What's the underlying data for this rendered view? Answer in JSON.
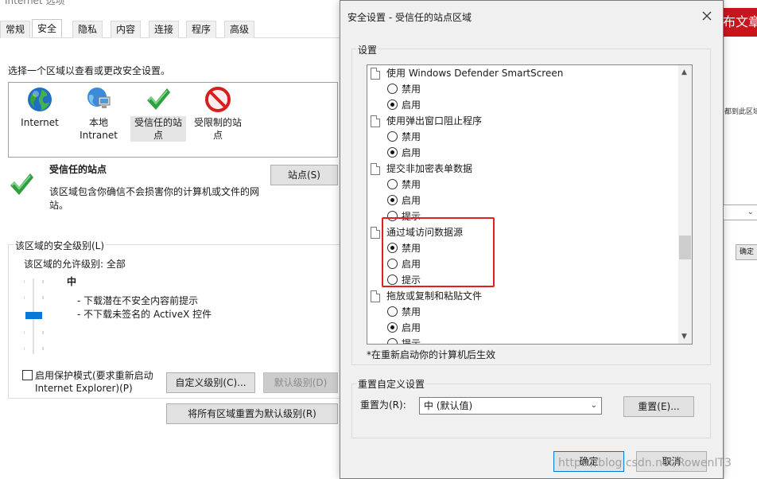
{
  "background_window": {
    "title": "Internet 选项",
    "tabs": [
      "常规",
      "安全",
      "隐私",
      "内容",
      "连接",
      "程序",
      "高级"
    ],
    "active_tab": "安全",
    "instruction": "选择一个区域以查看或更改安全设置。",
    "zones": [
      {
        "label": "Internet",
        "icon": "globe-icon"
      },
      {
        "label": "本地\nIntranet",
        "icon": "intranet-icon"
      },
      {
        "label": "受信任的站\n点",
        "icon": "green-check-icon",
        "selected": true
      },
      {
        "label": "受限制的站\n点",
        "icon": "restricted-icon"
      }
    ],
    "zone_title": "受信任的站点",
    "zone_desc": "该区域包含你确信不会损害你的计算机或文件的网站。",
    "sites_button": "站点(S)",
    "security_level_group": "该区域的安全级别(L)",
    "allowed_levels": "该区域的允许级别: 全部",
    "level_name": "中",
    "level_bullets": [
      "- 下载潜在不安全内容前提示",
      "- 不下载未签名的 ActiveX 控件"
    ],
    "protected_mode": "启用保护模式(要求重新启动 Internet Explorer)(P)",
    "protected_mode_line1": "启用保护模式(要求重新启动",
    "protected_mode_line2": "Internet Explorer)(P)",
    "custom_level_button": "自定义级别(C)...",
    "default_level_button": "默认级别(D)",
    "reset_all_button": "将所有区域重置为默认级别(R)"
  },
  "dialog": {
    "title": "安全设置 - 受信任的站点区域",
    "settings_group": "设置",
    "settings": [
      {
        "type": "head",
        "label": "使用 Windows Defender SmartScreen"
      },
      {
        "type": "opt",
        "label": "禁用",
        "checked": false
      },
      {
        "type": "opt",
        "label": "启用",
        "checked": true
      },
      {
        "type": "head",
        "label": "使用弹出窗口阻止程序"
      },
      {
        "type": "opt",
        "label": "禁用",
        "checked": false
      },
      {
        "type": "opt",
        "label": "启用",
        "checked": true
      },
      {
        "type": "head",
        "label": "提交非加密表单数据"
      },
      {
        "type": "opt",
        "label": "禁用",
        "checked": false
      },
      {
        "type": "opt",
        "label": "启用",
        "checked": true
      },
      {
        "type": "opt",
        "label": "提示",
        "checked": false
      },
      {
        "type": "head",
        "label": "通过域访问数据源"
      },
      {
        "type": "opt",
        "label": "禁用",
        "checked": true
      },
      {
        "type": "opt",
        "label": "启用",
        "checked": false
      },
      {
        "type": "opt",
        "label": "提示",
        "checked": false
      },
      {
        "type": "head",
        "label": "拖放或复制和粘贴文件"
      },
      {
        "type": "opt",
        "label": "禁用",
        "checked": false
      },
      {
        "type": "opt",
        "label": "启用",
        "checked": true
      },
      {
        "type": "opt",
        "label": "提示",
        "checked": false
      }
    ],
    "restart_note": "*在重新启动你的计算机后生效",
    "reset_group": "重置自定义设置",
    "reset_to_label": "重置为(R):",
    "reset_to_value": "中 (默认值)",
    "reset_button": "重置(E)...",
    "ok_button": "确定",
    "cancel_button": "取消"
  },
  "right_sliver": {
    "banner": "布文章",
    "fragment": "都到此区域",
    "ok_fragment": "确定"
  },
  "watermark": "https://blog.csdn.net/RowenIT3",
  "colors": {
    "accent": "#0078d7",
    "highlight_box": "#e02020",
    "banner": "#c9151e"
  }
}
